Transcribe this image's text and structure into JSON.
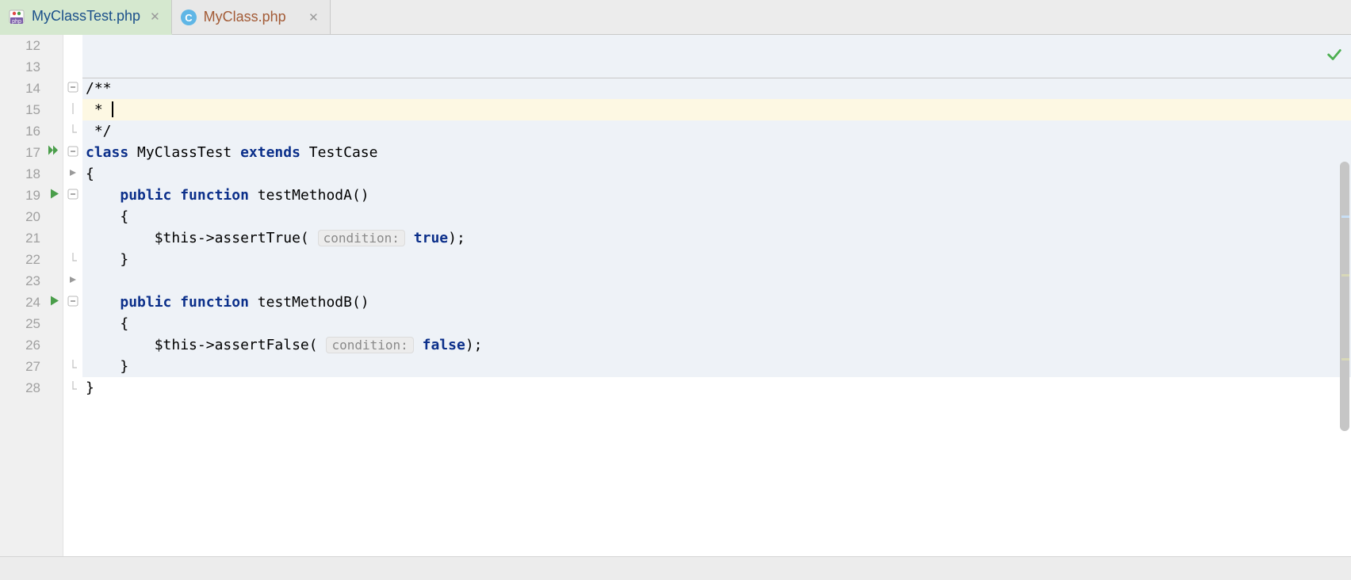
{
  "tabs": [
    {
      "label": "MyClassTest.php",
      "active": true,
      "icon": "php"
    },
    {
      "label": "MyClass.php",
      "active": false,
      "icon": "class"
    }
  ],
  "lines": {
    "start": 12,
    "end": 28,
    "rows": [
      {
        "n": 12,
        "bg": "blue",
        "tokens": []
      },
      {
        "n": 13,
        "bg": "blue",
        "tokens": []
      },
      {
        "n": 14,
        "bg": "blue",
        "fold": "minus",
        "tokens": [
          {
            "t": "/**",
            "c": "plain"
          }
        ]
      },
      {
        "n": 15,
        "bg": "yellow",
        "fold": "bar",
        "cursor": true,
        "tokens": [
          {
            "t": " * ",
            "c": "plain"
          }
        ]
      },
      {
        "n": 16,
        "bg": "blue",
        "fold": "end",
        "tokens": [
          {
            "t": " */",
            "c": "plain"
          }
        ]
      },
      {
        "n": 17,
        "bg": "blue",
        "run": "double",
        "fold": "minus",
        "tokens": [
          {
            "t": "class ",
            "c": "kw"
          },
          {
            "t": "MyClassTest ",
            "c": "plain"
          },
          {
            "t": "extends ",
            "c": "kw"
          },
          {
            "t": "TestCase",
            "c": "plain"
          }
        ]
      },
      {
        "n": 18,
        "bg": "blue",
        "fold": "play-gray",
        "tokens": [
          {
            "t": "{",
            "c": "plain"
          }
        ]
      },
      {
        "n": 19,
        "bg": "blue",
        "run": "single",
        "fold": "minus",
        "indent": 1,
        "tokens": [
          {
            "t": "public ",
            "c": "kw"
          },
          {
            "t": "function ",
            "c": "kw"
          },
          {
            "t": "testMethodA()",
            "c": "plain"
          }
        ]
      },
      {
        "n": 20,
        "bg": "blue",
        "indent": 1,
        "tokens": [
          {
            "t": "{",
            "c": "plain"
          }
        ]
      },
      {
        "n": 21,
        "bg": "blue",
        "indent": 2,
        "tokens": [
          {
            "t": "$this",
            "c": "plain"
          },
          {
            "t": "->assertTrue( ",
            "c": "plain"
          },
          {
            "t": "condition:",
            "c": "hint"
          },
          {
            "t": " ",
            "c": "plain"
          },
          {
            "t": "true",
            "c": "kw"
          },
          {
            "t": ");",
            "c": "plain"
          }
        ]
      },
      {
        "n": 22,
        "bg": "blue",
        "fold": "end",
        "indent": 1,
        "tokens": [
          {
            "t": "}",
            "c": "plain"
          }
        ]
      },
      {
        "n": 23,
        "bg": "blue",
        "fold": "play-gray",
        "tokens": []
      },
      {
        "n": 24,
        "bg": "blue",
        "run": "single",
        "fold": "minus",
        "indent": 1,
        "tokens": [
          {
            "t": "public ",
            "c": "kw"
          },
          {
            "t": "function ",
            "c": "kw"
          },
          {
            "t": "testMethodB()",
            "c": "plain"
          }
        ]
      },
      {
        "n": 25,
        "bg": "blue",
        "indent": 1,
        "tokens": [
          {
            "t": "{",
            "c": "plain"
          }
        ]
      },
      {
        "n": 26,
        "bg": "blue",
        "indent": 2,
        "tokens": [
          {
            "t": "$this",
            "c": "plain"
          },
          {
            "t": "->assertFalse( ",
            "c": "plain"
          },
          {
            "t": "condition:",
            "c": "hint"
          },
          {
            "t": " ",
            "c": "plain"
          },
          {
            "t": "false",
            "c": "kw"
          },
          {
            "t": ");",
            "c": "plain"
          }
        ]
      },
      {
        "n": 27,
        "bg": "blue",
        "fold": "end",
        "indent": 1,
        "tokens": [
          {
            "t": "}",
            "c": "plain"
          }
        ]
      },
      {
        "n": 28,
        "bg": "white",
        "fold": "end",
        "tokens": [
          {
            "t": "}",
            "c": "plain"
          }
        ]
      }
    ]
  },
  "indentUnit": "    "
}
